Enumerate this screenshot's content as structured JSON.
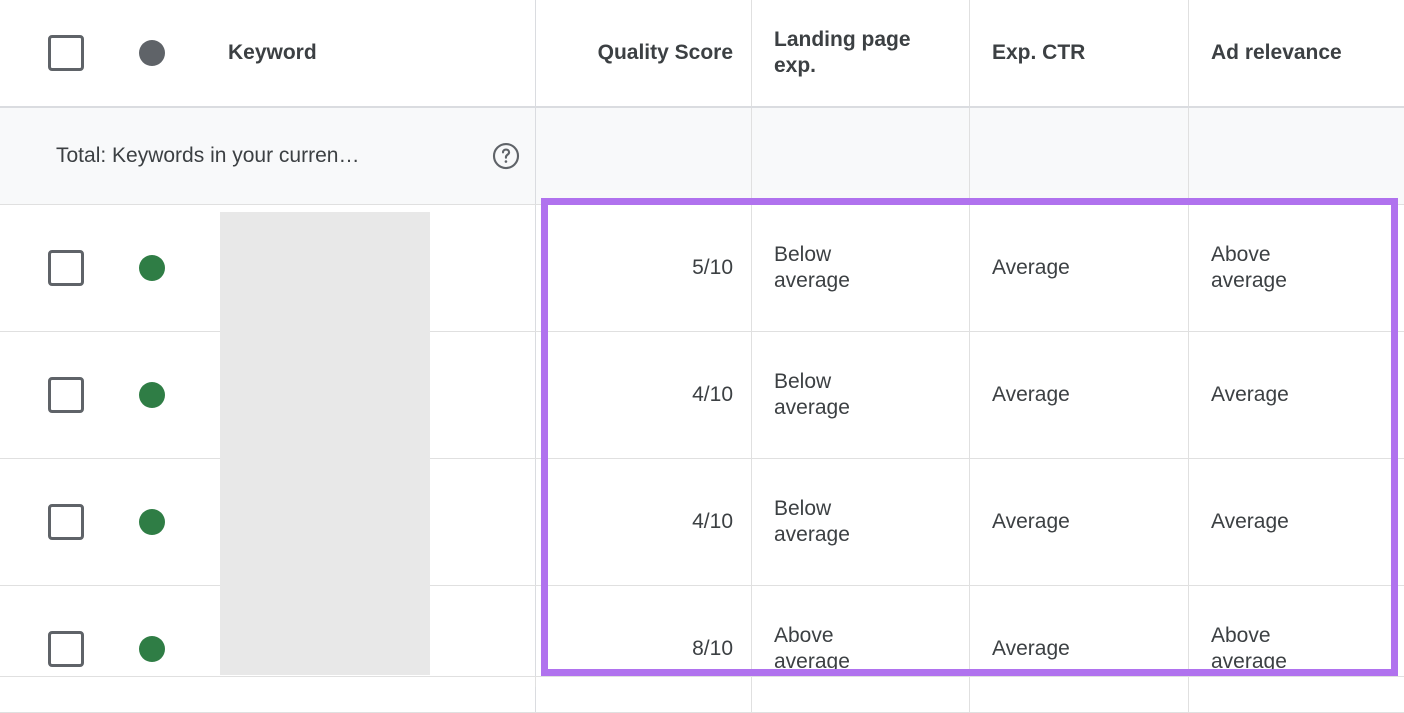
{
  "table": {
    "columns": [
      {
        "key": "keyword",
        "label": "Keyword",
        "align": "left"
      },
      {
        "key": "quality_score",
        "label": "Quality Score",
        "align": "right"
      },
      {
        "key": "landing_page",
        "label": "Landing page\nexp.",
        "align": "left"
      },
      {
        "key": "exp_ctr",
        "label": "Exp. CTR",
        "align": "left"
      },
      {
        "key": "ad_relevance",
        "label": "Ad relevance",
        "align": "left"
      }
    ],
    "header": {
      "select_all_checkbox": "unchecked",
      "status_dot": "grey",
      "keyword_label": "Keyword",
      "quality_score_label": "Quality Score",
      "landing_page_label": "Landing page exp.",
      "exp_ctr_label": "Exp. CTR",
      "ad_relevance_label": "Ad relevance"
    },
    "totals_row": {
      "label": "Total: Keywords in your curren…",
      "help_icon": "help-circle-icon",
      "quality_score": "",
      "landing_page": "",
      "exp_ctr": "",
      "ad_relevance": ""
    },
    "rows": [
      {
        "checkbox": "unchecked",
        "status": "green",
        "keyword": "",
        "quality_score": "5/10",
        "landing_page": "Below\naverage",
        "exp_ctr": "Average",
        "ad_relevance": "Above\naverage"
      },
      {
        "checkbox": "unchecked",
        "status": "green",
        "keyword": "",
        "quality_score": "4/10",
        "landing_page": "Below\naverage",
        "exp_ctr": "Average",
        "ad_relevance": "Average"
      },
      {
        "checkbox": "unchecked",
        "status": "green",
        "keyword": "",
        "quality_score": "4/10",
        "landing_page": "Below\naverage",
        "exp_ctr": "Average",
        "ad_relevance": "Average"
      },
      {
        "checkbox": "unchecked",
        "status": "green",
        "keyword": "",
        "quality_score": "8/10",
        "landing_page": "Above\naverage",
        "exp_ctr": "Average",
        "ad_relevance": "Above\naverage"
      }
    ]
  },
  "annotation": {
    "highlight_color": "#b072ee",
    "highlight_description": "purple rectangle outlining the Quality Score, Landing page exp., Exp. CTR and Ad relevance columns for the four keyword rows"
  },
  "colors": {
    "status_active": "#2f7d45",
    "status_header": "#5f6368",
    "text": "#3c4043",
    "grid_line": "#e0e0e0",
    "totals_background": "#f8f9fa",
    "redaction": "#e8e8e8"
  }
}
